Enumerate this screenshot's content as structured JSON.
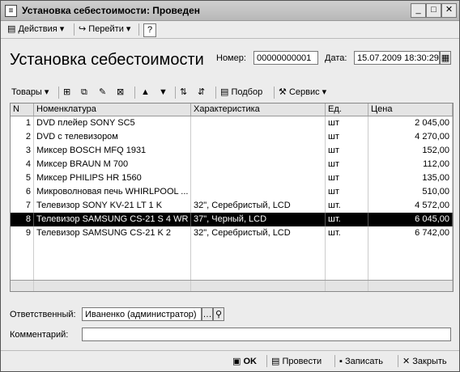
{
  "window": {
    "title": "Установка себестоимости: Проведен"
  },
  "toolbar": {
    "actions": "Действия",
    "goto": "Перейти",
    "help": "?"
  },
  "doc": {
    "title": "Установка себестоимости",
    "number_label": "Номер:",
    "number_value": "00000000001",
    "date_label": "Дата:",
    "date_value": "15.07.2009 18:30:29"
  },
  "tabletoolbar": {
    "goods": "Товары",
    "select": "Подбор",
    "service": "Сервис"
  },
  "table": {
    "headers": [
      "N",
      "Номенклатура",
      "Характеристика",
      "Ед.",
      "Цена"
    ],
    "rows": [
      {
        "n": "1",
        "name": "DVD плейер SONY SC5",
        "char": "",
        "unit": "шт",
        "price": "2 045,00"
      },
      {
        "n": "2",
        "name": "DVD с телевизором",
        "char": "",
        "unit": "шт",
        "price": "4 270,00"
      },
      {
        "n": "3",
        "name": "Миксер BOSCH MFQ 1931",
        "char": "",
        "unit": "шт",
        "price": "152,00"
      },
      {
        "n": "4",
        "name": "Миксер BRAUN M 700",
        "char": "",
        "unit": "шт",
        "price": "112,00"
      },
      {
        "n": "5",
        "name": "Миксер PHILIPS HR 1560",
        "char": "",
        "unit": "шт",
        "price": "135,00"
      },
      {
        "n": "6",
        "name": "Микроволновая печь WHIRLPOOL ...",
        "char": "",
        "unit": "шт",
        "price": "510,00"
      },
      {
        "n": "7",
        "name": "Телевизор SONY KV-21 LT 1 K",
        "char": "32\", Серебристый, LCD",
        "unit": "шт.",
        "price": "4 572,00"
      },
      {
        "n": "8",
        "name": "Телевизор SAMSUNG CS-21 S 4 WR",
        "char": "37\", Черный, LCD",
        "unit": "шт.",
        "price": "6 045,00"
      },
      {
        "n": "9",
        "name": "Телевизор SAMSUNG CS-21 K 2",
        "char": "32\", Серебристый, LCD",
        "unit": "шт.",
        "price": "6 742,00"
      }
    ]
  },
  "form": {
    "responsible_label": "Ответственный:",
    "responsible_value": "Иваненко (администратор)",
    "comment_label": "Комментарий:",
    "comment_value": ""
  },
  "footer": {
    "ok": "OK",
    "post": "Провести",
    "save": "Записать",
    "close": "Закрыть"
  }
}
